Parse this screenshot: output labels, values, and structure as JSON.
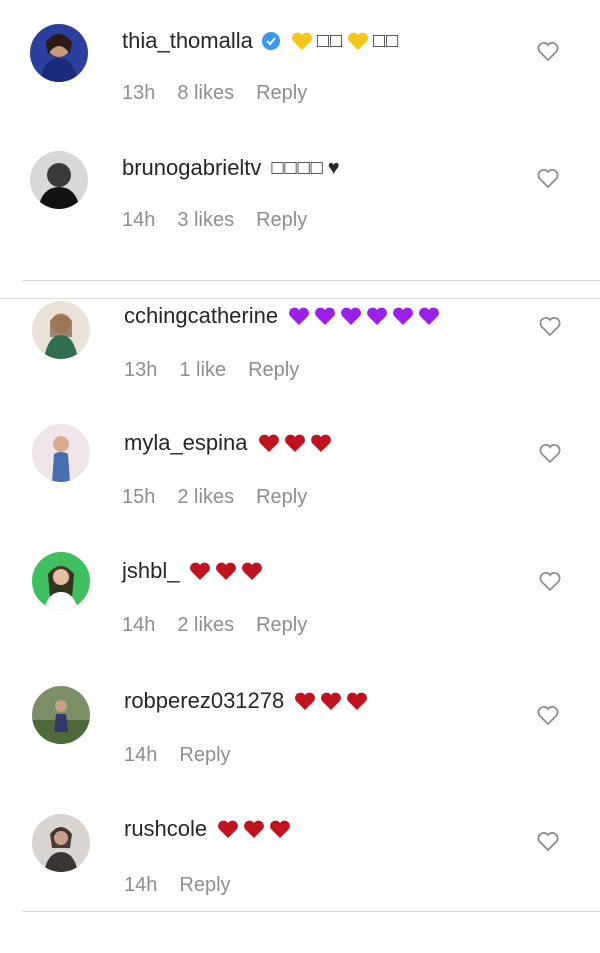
{
  "colors": {
    "heart_red": "#c1121f",
    "heart_purple": "#9b1fe8",
    "heart_yellow": "#f5c518",
    "verified": "#3897f0",
    "meta_gray": "#8e8e8e"
  },
  "comments": [
    {
      "username": "thia_thomalla",
      "verified": true,
      "text_glyphs": "□□",
      "text_glyphs_2": "□□",
      "time": "13h",
      "likes": "8 likes",
      "reply": "Reply",
      "hearts": [
        "yellow"
      ],
      "hearts_mid": [
        "yellow"
      ]
    },
    {
      "username": "brunogabrieltv",
      "text_glyphs": "□□□□",
      "text_suffix": "♥",
      "time": "14h",
      "likes": "3 likes",
      "reply": "Reply"
    },
    {
      "username": "cchingcatherine",
      "time": "13h",
      "likes": "1 like",
      "reply": "Reply",
      "hearts": [
        "purple",
        "purple",
        "purple",
        "purple",
        "purple",
        "purple"
      ]
    },
    {
      "username": "myla_espina",
      "time": "15h",
      "likes": "2 likes",
      "reply": "Reply",
      "hearts": [
        "red",
        "red",
        "red"
      ]
    },
    {
      "username": "jshbl_",
      "time": "14h",
      "likes": "2 likes",
      "reply": "Reply",
      "hearts": [
        "red",
        "red",
        "red"
      ]
    },
    {
      "username": "robperez031278",
      "time": "14h",
      "reply": "Reply",
      "hearts": [
        "red",
        "red",
        "red"
      ]
    },
    {
      "username": "rushcole",
      "time": "14h",
      "reply": "Reply",
      "hearts": [
        "red",
        "red",
        "red"
      ]
    }
  ]
}
